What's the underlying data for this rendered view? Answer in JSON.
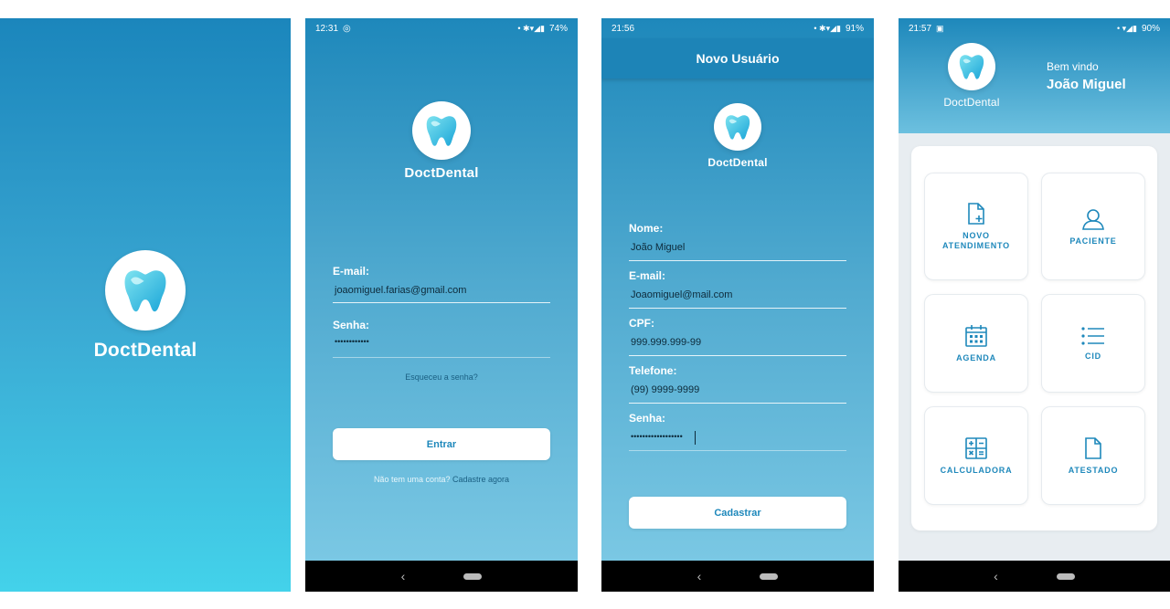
{
  "brand": {
    "name": "DoctDental"
  },
  "login": {
    "status_time": "12:31",
    "battery": "74%",
    "email_label": "E-mail:",
    "email_value": "joaomiguel.farias@gmail.com",
    "password_label": "Senha:",
    "password_value": "••••••••••••",
    "forgot_link": "Esqueceu a senha?",
    "enter_button": "Entrar",
    "no_account_text": "Não tem uma conta?",
    "signup_link": "Cadastre agora"
  },
  "register": {
    "status_time": "21:56",
    "battery": "91%",
    "title": "Novo Usuário",
    "fields": [
      {
        "label": "Nome:",
        "value": "João Miguel"
      },
      {
        "label": "E-mail:",
        "value": "Joaomiguel@mail.com"
      },
      {
        "label": "CPF:",
        "value": "999.999.999-99"
      },
      {
        "label": "Telefone:",
        "value": "(99) 9999-9999"
      },
      {
        "label": "Senha:",
        "value": "••••••••••••••••••"
      }
    ],
    "submit_button": "Cadastrar"
  },
  "dashboard": {
    "status_time": "21:57",
    "battery": "90%",
    "welcome_text": "Bem vindo",
    "user_name": "João Miguel",
    "tiles": [
      {
        "label": "NOVO\nATENDIMENTO",
        "icon": "new-document-icon"
      },
      {
        "label": "PACIENTE",
        "icon": "user-icon"
      },
      {
        "label": "AGENDA",
        "icon": "calendar-icon"
      },
      {
        "label": "CID",
        "icon": "list-icon"
      },
      {
        "label": "CALCULADORA",
        "icon": "calculator-icon"
      },
      {
        "label": "ATESTADO",
        "icon": "document-icon"
      }
    ]
  },
  "nav": {
    "back_glyph": "‹"
  },
  "colors": {
    "accent": "#1e88bb",
    "splash_bottom": "#43d2ea",
    "dashboard_bg": "#e8edf1"
  }
}
